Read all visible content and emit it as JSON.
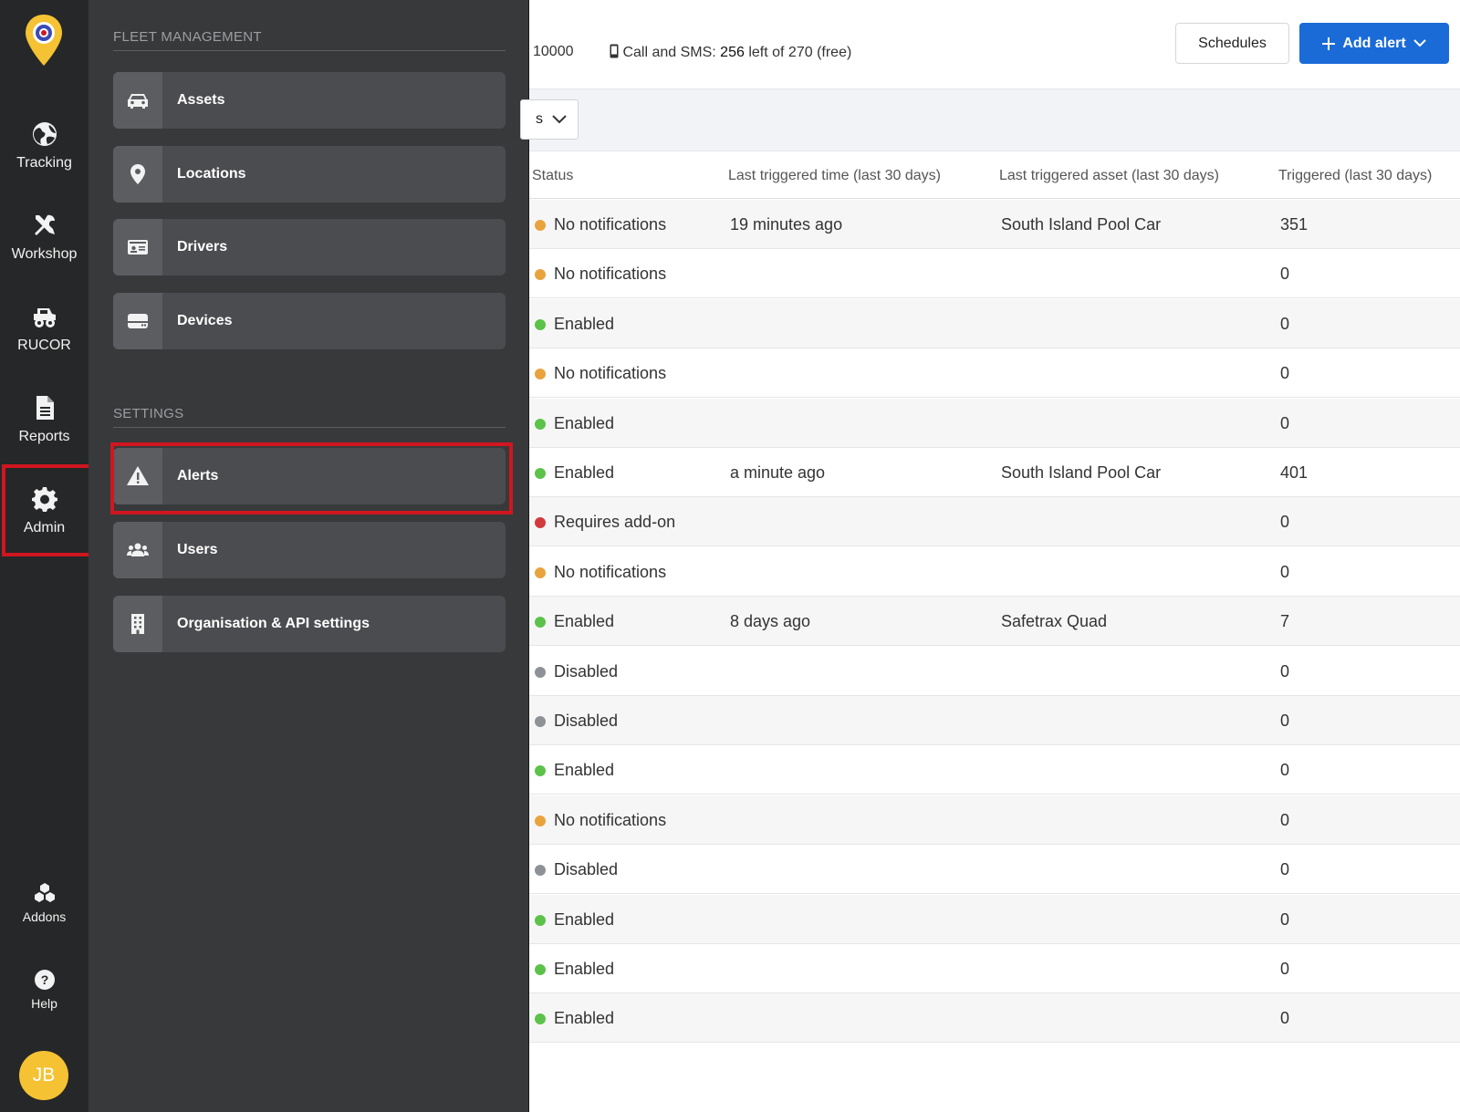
{
  "rail": {
    "items": [
      {
        "label": "Tracking",
        "icon": "globe-icon"
      },
      {
        "label": "Workshop",
        "icon": "tools-icon"
      },
      {
        "label": "RUCOR",
        "icon": "truck-icon"
      },
      {
        "label": "Reports",
        "icon": "report-icon"
      },
      {
        "label": "Admin",
        "icon": "gear-icon",
        "active": true
      },
      {
        "label": "Addons",
        "icon": "cubes-icon"
      },
      {
        "label": "Help",
        "icon": "help-icon"
      }
    ],
    "avatar_initials": "JB"
  },
  "menu": {
    "fleet_title": "FLEET MANAGEMENT",
    "fleet_items": [
      {
        "label": "Assets",
        "icon": "car-icon"
      },
      {
        "label": "Locations",
        "icon": "map-pin-icon"
      },
      {
        "label": "Drivers",
        "icon": "id-card-icon"
      },
      {
        "label": "Devices",
        "icon": "device-icon"
      }
    ],
    "settings_title": "SETTINGS",
    "settings_items": [
      {
        "label": "Alerts",
        "icon": "warning-icon",
        "highlighted": true
      },
      {
        "label": "Users",
        "icon": "users-icon"
      },
      {
        "label": "Organisation & API settings",
        "icon": "building-icon"
      }
    ]
  },
  "topbar": {
    "quota_partial": "10000",
    "sms_label": "Call and SMS:",
    "sms_used": "256",
    "sms_left_of": "left of",
    "sms_total": "270",
    "sms_suffix": "(free)",
    "schedules_label": "Schedules",
    "add_alert_label": "Add alert"
  },
  "filter": {
    "partial_text": "s"
  },
  "table": {
    "headers": {
      "status": "Status",
      "time": "Last triggered time (last 30 days)",
      "asset": "Last triggered asset (last 30 days)",
      "count": "Triggered (last 30 days)"
    },
    "rows": [
      {
        "status": "No notifications",
        "color": "#e8a33d",
        "time": "19 minutes ago",
        "asset": "South Island Pool Car",
        "count": "351"
      },
      {
        "status": "No notifications",
        "color": "#e8a33d",
        "time": "",
        "asset": "",
        "count": "0"
      },
      {
        "status": "Enabled",
        "color": "#5cc24a",
        "time": "",
        "asset": "",
        "count": "0"
      },
      {
        "status": "No notifications",
        "color": "#e8a33d",
        "time": "",
        "asset": "",
        "count": "0"
      },
      {
        "status": "Enabled",
        "color": "#5cc24a",
        "time": "",
        "asset": "",
        "count": "0"
      },
      {
        "status": "Enabled",
        "color": "#5cc24a",
        "time": "a minute ago",
        "asset": "South Island Pool Car",
        "count": "401"
      },
      {
        "status": "Requires add-on",
        "color": "#d23b3b",
        "time": "",
        "asset": "",
        "count": "0"
      },
      {
        "status": "No notifications",
        "color": "#e8a33d",
        "time": "",
        "asset": "",
        "count": "0"
      },
      {
        "status": "Enabled",
        "color": "#5cc24a",
        "time": "8 days ago",
        "asset": "Safetrax Quad",
        "count": "7"
      },
      {
        "status": "Disabled",
        "color": "#8e9196",
        "time": "",
        "asset": "",
        "count": "0"
      },
      {
        "status": "Disabled",
        "color": "#8e9196",
        "time": "",
        "asset": "",
        "count": "0"
      },
      {
        "status": "Enabled",
        "color": "#5cc24a",
        "time": "",
        "asset": "",
        "count": "0"
      },
      {
        "status": "No notifications",
        "color": "#e8a33d",
        "time": "",
        "asset": "",
        "count": "0"
      },
      {
        "status": "Disabled",
        "color": "#8e9196",
        "time": "",
        "asset": "",
        "count": "0"
      },
      {
        "status": "Enabled",
        "color": "#5cc24a",
        "time": "",
        "asset": "",
        "count": "0"
      },
      {
        "status": "Enabled",
        "color": "#5cc24a",
        "time": "",
        "asset": "",
        "count": "0"
      },
      {
        "status": "Enabled",
        "color": "#5cc24a",
        "time": "",
        "asset": "",
        "count": "0"
      }
    ]
  },
  "colors": {
    "rail_bg": "#262728",
    "menu_bg": "#38393b",
    "accent": "#1a6bd8",
    "highlight": "#d0161f",
    "avatar": "#f4c233"
  }
}
